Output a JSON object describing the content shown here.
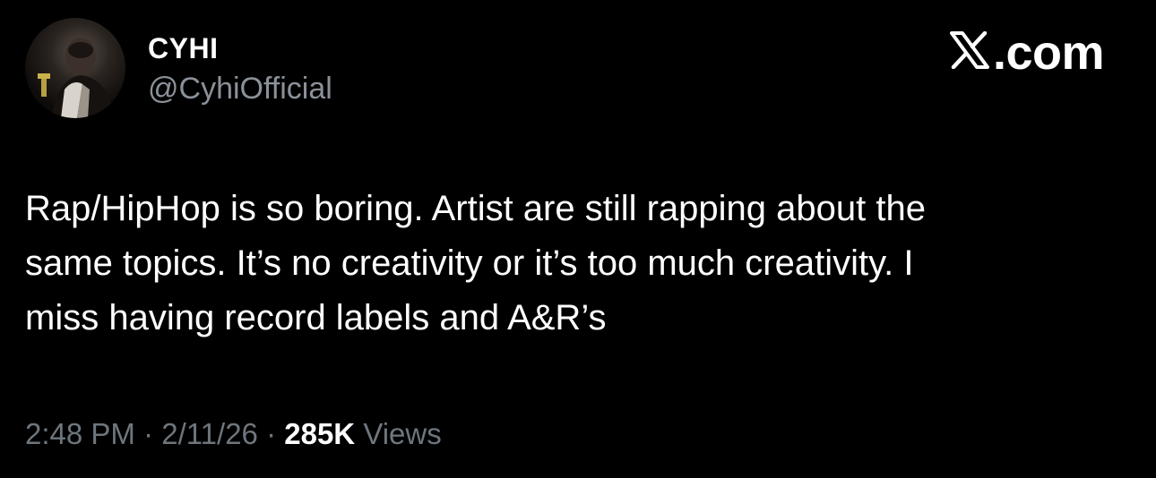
{
  "author": {
    "display_name": "CYHI",
    "handle": "@CyhiOfficial",
    "avatar_icon": "profile-photo"
  },
  "brand": {
    "logo_icon": "x-logo-icon",
    "suffix": ".com"
  },
  "tweet": {
    "text": "Rap/HipHop is so boring. Artist are still rapping about the\nsame topics. It’s no creativity or it’s too much creativity. I\nmiss having record labels and A&R’s"
  },
  "meta": {
    "time": "2:48 PM",
    "separator": "·",
    "date": "2/11/26",
    "views_count": "285K",
    "views_label": "Views"
  },
  "colors": {
    "background": "#000000",
    "text_primary": "#ffffff",
    "text_secondary": "#6e767d"
  }
}
